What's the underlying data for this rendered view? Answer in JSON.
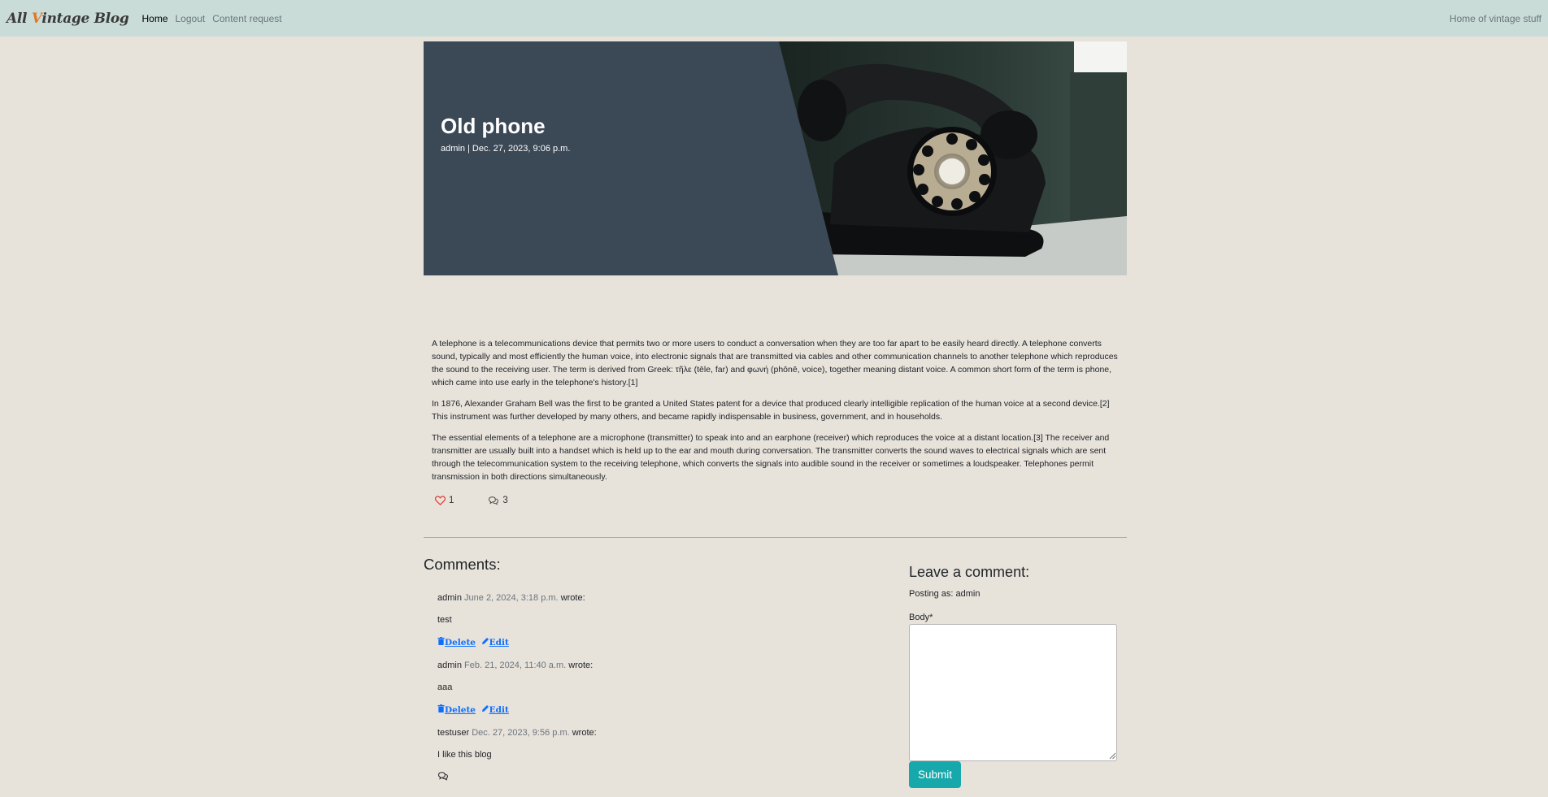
{
  "navbar": {
    "brand": {
      "prefix": "All ",
      "accent": "V",
      "suffix": "intage Blog"
    },
    "links": [
      "Home",
      "Logout",
      "Content request"
    ],
    "tagline": "Home of vintage stuff"
  },
  "post": {
    "title": "Old phone",
    "meta": "admin | Dec. 27, 2023, 9:06 p.m.",
    "paragraphs": [
      "A telephone is a telecommunications device that permits two or more users to conduct a conversation when they are too far apart to be easily heard directly. A telephone converts sound, typically and most efficiently the human voice, into electronic signals that are transmitted via cables and other communication channels to another telephone which reproduces the sound to the receiving user. The term is derived from Greek: τῆλε (tēle, far) and φωνή (phōnē, voice), together meaning distant voice. A common short form of the term is phone, which came into use early in the telephone's history.[1]",
      "In 1876, Alexander Graham Bell was the first to be granted a United States patent for a device that produced clearly intelligible replication of the human voice at a second device.[2] This instrument was further developed by many others, and became rapidly indispensable in business, government, and in households.",
      "The essential elements of a telephone are a microphone (transmitter) to speak into and an earphone (receiver) which reproduces the voice at a distant location.[3] The receiver and transmitter are usually built into a handset which is held up to the ear and mouth during conversation. The transmitter converts the sound waves to electrical signals which are sent through the telecommunication system to the receiving telephone, which converts the signals into audible sound in the receiver or sometimes a loudspeaker. Telephones permit transmission in both directions simultaneously."
    ],
    "likes": "1",
    "comment_count": "3",
    "icons": {
      "like": "heart-icon",
      "comments": "chat-bubbles-icon"
    },
    "accent_color": "#e0443a"
  },
  "comments": {
    "title": "Comments:",
    "items": [
      {
        "author": "admin",
        "date": "June 2, 2024, 3:18 p.m.",
        "wrote": "wrote:",
        "body": "test",
        "delete": "Delete",
        "edit": "Edit"
      },
      {
        "author": "admin",
        "date": "Feb. 21, 2024, 11:40 a.m.",
        "wrote": "wrote:",
        "body": "aaa",
        "delete": "Delete",
        "edit": "Edit"
      },
      {
        "author": "testuser",
        "date": "Dec. 27, 2023, 9:56 p.m.",
        "wrote": "wrote:",
        "body": "I like this blog"
      }
    ]
  },
  "form": {
    "title": "Leave a comment:",
    "posting_as": "Posting as: admin",
    "body_label": "Body*",
    "body_value": "",
    "submit": "Submit",
    "submit_color": "#17a8ac"
  }
}
